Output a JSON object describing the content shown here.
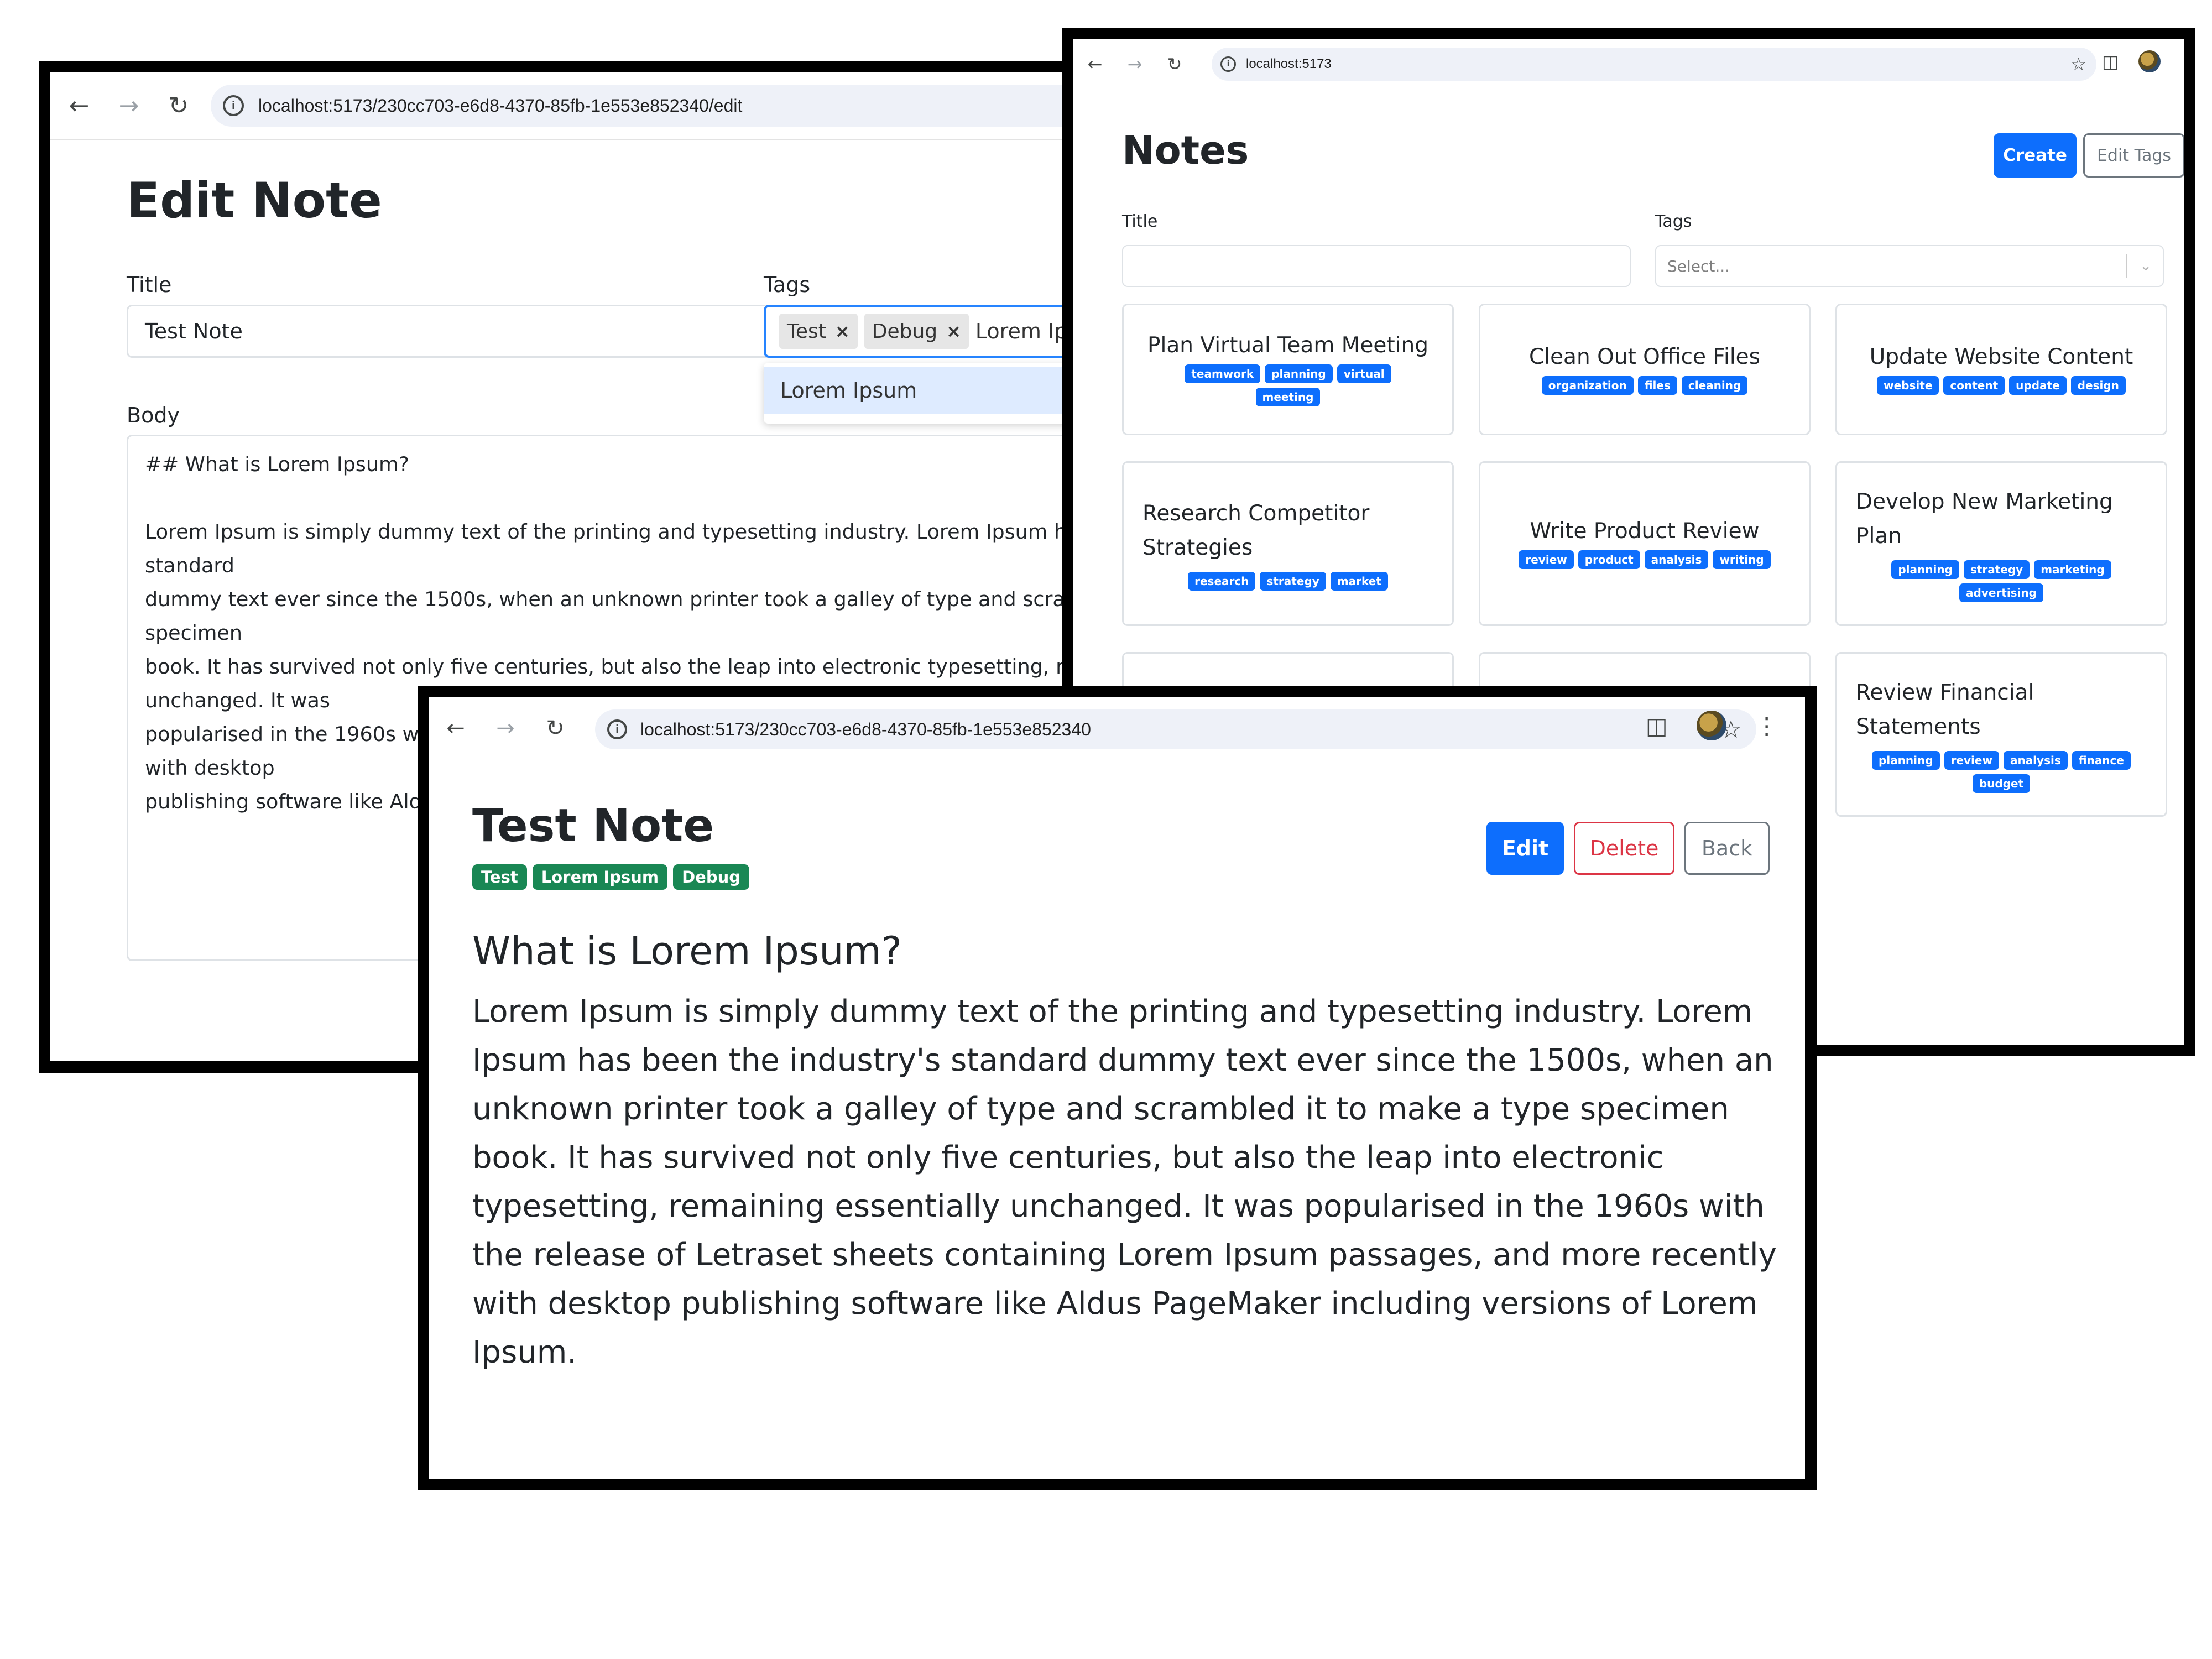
{
  "edit_window": {
    "url": "localhost:5173/230cc703-e6d8-4370-85fb-1e553e852340/edit",
    "heading": "Edit Note",
    "title_label": "Title",
    "title_value": "Test Note",
    "tags_label": "Tags",
    "selected_tags": [
      "Test",
      "Debug"
    ],
    "tags_input_value": "Lorem Ipsum",
    "dropdown_option": "Lorem Ipsum",
    "body_label": "Body",
    "body_value": "## What is Lorem Ipsum?\n\nLorem Ipsum is simply dummy text of the printing and typesetting industry. Lorem Ipsum has been the industry's standard\ndummy text ever since the 1500s, when an unknown printer took a galley of type and scrambled it to make a type specimen\nbook. It has survived not only five centuries, but also the leap into electronic typesetting, remaining essentially unchanged. It was\npopularised in the 1960s with the release of Letraset sheets containing Lorem Ipsum passages, and more recently with desktop\npublishing software like Aldus PageMaker including versions of Lorem Ipsum."
  },
  "notes_window": {
    "url": "localhost:5173",
    "heading": "Notes",
    "create_label": "Create",
    "edit_tags_label": "Edit Tags",
    "title_label": "Title",
    "tags_label": "Tags",
    "tags_placeholder": "Select...",
    "cards": [
      {
        "title": "Plan Virtual Team Meeting",
        "tags": [
          "teamwork",
          "planning",
          "virtual",
          "meeting"
        ]
      },
      {
        "title": "Clean Out Office Files",
        "tags": [
          "organization",
          "files",
          "cleaning"
        ]
      },
      {
        "title": "Update Website Content",
        "tags": [
          "website",
          "content",
          "update",
          "design"
        ]
      },
      {
        "title": "Research Competitor Strategies",
        "tags": [
          "research",
          "strategy",
          "market"
        ]
      },
      {
        "title": "Write Product Review",
        "tags": [
          "review",
          "product",
          "analysis",
          "writing"
        ]
      },
      {
        "title": "Develop New Marketing Plan",
        "tags": [
          "planning",
          "strategy",
          "marketing",
          "advertising"
        ]
      },
      {
        "title": "",
        "tags": []
      },
      {
        "title": "",
        "tags": []
      },
      {
        "title": "Review Financial Statements",
        "tags": [
          "planning",
          "review",
          "analysis",
          "finance",
          "budget"
        ]
      }
    ]
  },
  "view_window": {
    "url": "localhost:5173/230cc703-e6d8-4370-85fb-1e553e852340",
    "title": "Test Note",
    "tags": [
      "Test",
      "Lorem Ipsum",
      "Debug"
    ],
    "edit_label": "Edit",
    "delete_label": "Delete",
    "back_label": "Back",
    "body_heading": "What is Lorem Ipsum?",
    "body_paragraph": "Lorem Ipsum is simply dummy text of the printing and typesetting industry. Lorem Ipsum has been the industry's standard dummy text ever since the 1500s, when an unknown printer took a galley of type and scrambled it to make a type specimen book. It has survived not only five centuries, but also the leap into electronic typesetting, remaining essentially unchanged. It was popularised in the 1960s with the release of Letraset sheets containing Lorem Ipsum passages, and more recently with desktop publishing software like Aldus PageMaker including versions of Lorem Ipsum."
  },
  "colors": {
    "primary": "#0d6efd",
    "success": "#198754",
    "danger": "#dc3545",
    "secondary": "#6c757d",
    "focus": "#2684ff",
    "option_highlight": "#deebff"
  },
  "icons": [
    "back-arrow-icon",
    "forward-arrow-icon",
    "reload-icon",
    "site-info-icon",
    "bookmark-star-icon",
    "extensions-icon",
    "profile-avatar",
    "kebab-menu-icon",
    "chip-remove-icon",
    "chevron-down-icon"
  ]
}
